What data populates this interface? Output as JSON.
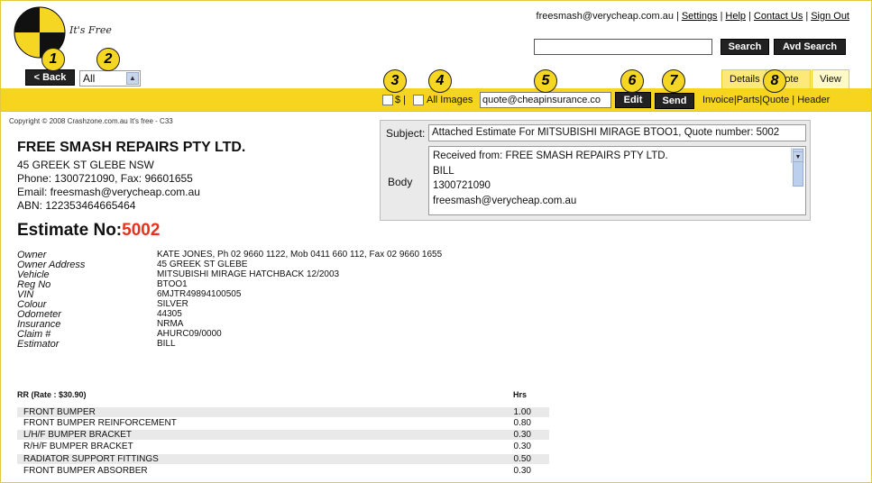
{
  "header": {
    "tagline": "It's Free",
    "email": "freesmash@verycheap.com.au",
    "links": [
      "Settings",
      "Help",
      "Contact Us",
      "Sign Out"
    ],
    "search_button": "Search",
    "avd_search_button": "Avd Search",
    "back_button": "< Back",
    "filter_value": "All",
    "tabs": [
      "Details",
      "Note",
      "View"
    ]
  },
  "callouts": [
    "1",
    "2",
    "3",
    "4",
    "5",
    "6",
    "7",
    "8"
  ],
  "toolbar": {
    "dollar_label": "$",
    "all_images_label": "All Images",
    "email_value": "quote@cheapinsurance.co",
    "edit_button": "Edit",
    "send_button": "Send",
    "links": [
      "Invoice",
      "Parts",
      "Quote",
      "Header"
    ]
  },
  "copyright": "Copyright © 2008 Crashzone.com.au It's free - C33",
  "company": {
    "name": "FREE SMASH REPAIRS PTY LTD.",
    "address": "45 GREEK ST GLEBE NSW",
    "phone": "Phone: 1300721090, Fax: 96601655",
    "email": "Email: freesmash@verycheap.com.au",
    "abn": "ABN: 122353464665464"
  },
  "estimate": {
    "label": "Estimate No:",
    "number": "5002"
  },
  "details": [
    {
      "key": "Owner",
      "value": "KATE JONES, Ph 02 9660 1122, Mob 0411 660 112, Fax 02 9660 1655"
    },
    {
      "key": "Owner Address",
      "value": "45 GREEK ST GLEBE"
    },
    {
      "key": "Vehicle",
      "value": "MITSUBISHI MIRAGE HATCHBACK 12/2003"
    },
    {
      "key": "Reg No",
      "value": "BTOO1"
    },
    {
      "key": "VIN",
      "value": "6MJTR49894100505"
    },
    {
      "key": "Colour",
      "value": "SILVER"
    },
    {
      "key": "Odometer",
      "value": "44305"
    },
    {
      "key": "Insurance",
      "value": "NRMA"
    },
    {
      "key": "Claim #",
      "value": "AHURC09/0000"
    },
    {
      "key": "Estimator",
      "value": "BILL"
    }
  ],
  "labour": {
    "title": "RR (Rate : $30.90)",
    "hrs_header": "Hrs",
    "rows": [
      {
        "desc": "FRONT BUMPER",
        "hrs": "1.00"
      },
      {
        "desc": "FRONT BUMPER REINFORCEMENT",
        "hrs": "0.80"
      },
      {
        "desc": "L/H/F BUMPER BRACKET",
        "hrs": "0.30"
      },
      {
        "desc": "R/H/F BUMPER BRACKET",
        "hrs": "0.30"
      },
      {
        "desc": "RADIATOR SUPPORT FITTINGS",
        "hrs": "0.50"
      },
      {
        "desc": "FRONT BUMPER ABSORBER",
        "hrs": "0.30"
      }
    ]
  },
  "mail": {
    "subject_label": "Subject:",
    "subject_value": "Attached Estimate For MITSUBISHI MIRAGE BTOO1, Quote number: 5002",
    "body_label": "Body",
    "body_lines": [
      "Received from: FREE SMASH REPAIRS PTY LTD.",
      "BILL",
      "1300721090",
      "freesmash@verycheap.com.au"
    ]
  }
}
